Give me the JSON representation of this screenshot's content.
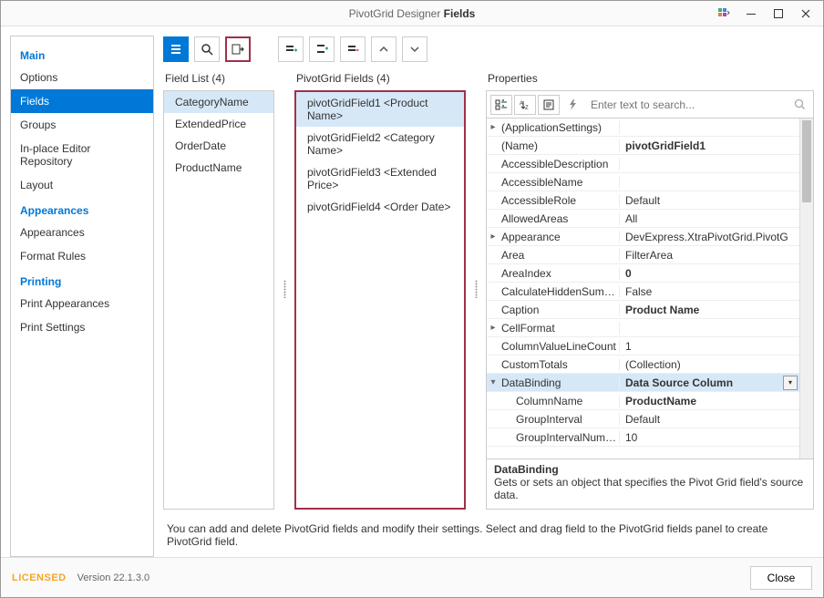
{
  "window": {
    "title_prefix": "PivotGrid Designer ",
    "title_bold": "Fields"
  },
  "sidebar": {
    "groups": [
      {
        "heading": "Main",
        "items": [
          {
            "label": "Options",
            "selected": false
          },
          {
            "label": "Fields",
            "selected": true
          },
          {
            "label": "Groups",
            "selected": false
          },
          {
            "label": "In-place Editor Repository",
            "selected": false
          },
          {
            "label": "Layout",
            "selected": false
          }
        ]
      },
      {
        "heading": "Appearances",
        "items": [
          {
            "label": "Appearances",
            "selected": false
          },
          {
            "label": "Format Rules",
            "selected": false
          }
        ]
      },
      {
        "heading": "Printing",
        "items": [
          {
            "label": "Print Appearances",
            "selected": false
          },
          {
            "label": "Print Settings",
            "selected": false
          }
        ]
      }
    ]
  },
  "fieldList": {
    "label": "Field List (4)",
    "items": [
      {
        "label": "CategoryName",
        "selected": true
      },
      {
        "label": "ExtendedPrice",
        "selected": false
      },
      {
        "label": "OrderDate",
        "selected": false
      },
      {
        "label": "ProductName",
        "selected": false
      }
    ]
  },
  "pivotFields": {
    "label": "PivotGrid Fields (4)",
    "items": [
      {
        "label": "pivotGridField1 <Product Name>",
        "selected": true
      },
      {
        "label": "pivotGridField2 <Category Name>",
        "selected": false
      },
      {
        "label": "pivotGridField3 <Extended Price>",
        "selected": false
      },
      {
        "label": "pivotGridField4 <Order Date>",
        "selected": false
      }
    ]
  },
  "properties": {
    "label": "Properties",
    "search_placeholder": "Enter text to search...",
    "rows": [
      {
        "exp": "▸",
        "name": "(ApplicationSettings)",
        "val": "",
        "bold": false
      },
      {
        "exp": "",
        "name": "(Name)",
        "val": "pivotGridField1",
        "bold": true
      },
      {
        "exp": "",
        "name": "AccessibleDescription",
        "val": "",
        "bold": false
      },
      {
        "exp": "",
        "name": "AccessibleName",
        "val": "",
        "bold": false
      },
      {
        "exp": "",
        "name": "AccessibleRole",
        "val": "Default",
        "bold": false
      },
      {
        "exp": "",
        "name": "AllowedAreas",
        "val": "All",
        "bold": false
      },
      {
        "exp": "▸",
        "name": "Appearance",
        "val": "DevExpress.XtraPivotGrid.PivotG",
        "bold": false
      },
      {
        "exp": "",
        "name": "Area",
        "val": "FilterArea",
        "bold": false
      },
      {
        "exp": "",
        "name": "AreaIndex",
        "val": "0",
        "bold": true
      },
      {
        "exp": "",
        "name": "CalculateHiddenSummaries",
        "val": "False",
        "bold": false
      },
      {
        "exp": "",
        "name": "Caption",
        "val": "Product Name",
        "bold": true
      },
      {
        "exp": "▸",
        "name": "CellFormat",
        "val": "",
        "bold": false
      },
      {
        "exp": "",
        "name": "ColumnValueLineCount",
        "val": "1",
        "bold": false
      },
      {
        "exp": "",
        "name": "CustomTotals",
        "val": "(Collection)",
        "bold": false
      },
      {
        "exp": "▾",
        "name": "DataBinding",
        "val": "Data Source Column",
        "bold": true,
        "selected": true,
        "dropdown": true
      },
      {
        "exp": "",
        "name": "ColumnName",
        "val": "ProductName",
        "bold": true,
        "indent": true
      },
      {
        "exp": "",
        "name": "GroupInterval",
        "val": "Default",
        "bold": false,
        "indent": true
      },
      {
        "exp": "",
        "name": "GroupIntervalNumericRa",
        "val": "10",
        "bold": false,
        "indent": true
      }
    ],
    "desc_title": "DataBinding",
    "desc_text": "Gets or sets an object that specifies the Pivot Grid field's source data."
  },
  "hint": "You can add and delete PivotGrid fields and modify their settings. Select and drag field to the PivotGrid fields panel to create PivotGrid field.",
  "footer": {
    "licensed": "LICENSED",
    "version": "Version 22.1.3.0",
    "close": "Close"
  }
}
